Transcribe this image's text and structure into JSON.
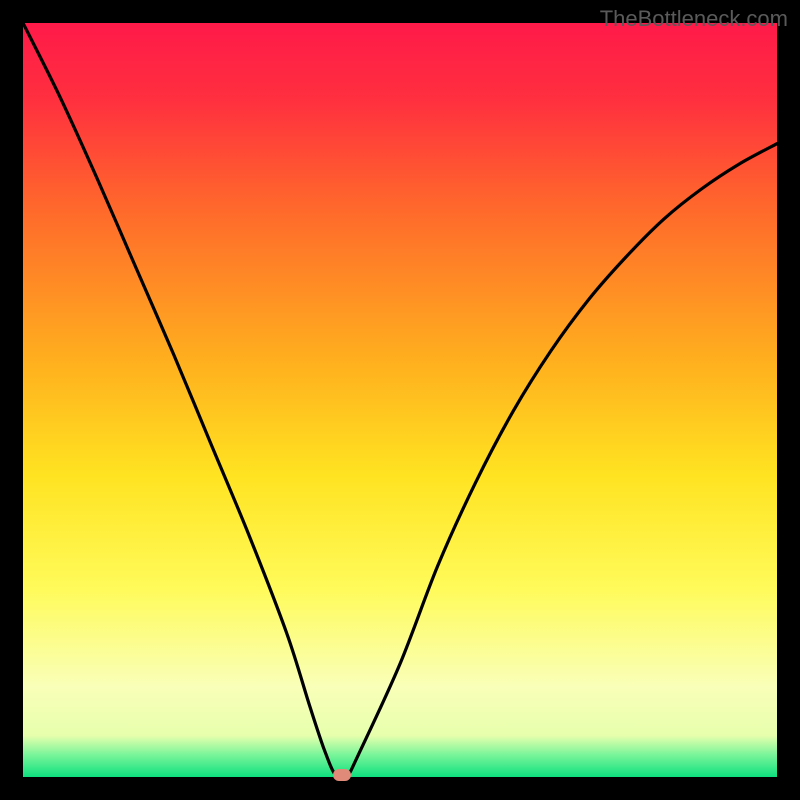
{
  "watermark": "TheBottleneck.com",
  "chart_data": {
    "type": "line",
    "title": "",
    "xlabel": "",
    "ylabel": "",
    "xlim": [
      0,
      100
    ],
    "ylim": [
      0,
      100
    ],
    "gradient_stops": [
      {
        "pos": 0.0,
        "color": "#ff1a49"
      },
      {
        "pos": 0.1,
        "color": "#ff2f3f"
      },
      {
        "pos": 0.25,
        "color": "#ff6a2b"
      },
      {
        "pos": 0.45,
        "color": "#ffb01e"
      },
      {
        "pos": 0.6,
        "color": "#ffe321"
      },
      {
        "pos": 0.75,
        "color": "#fffb5a"
      },
      {
        "pos": 0.88,
        "color": "#f9ffb8"
      },
      {
        "pos": 0.945,
        "color": "#e7ffad"
      },
      {
        "pos": 0.97,
        "color": "#7cf59a"
      },
      {
        "pos": 1.0,
        "color": "#0ee07f"
      }
    ],
    "series": [
      {
        "name": "bottleneck-curve",
        "x": [
          0,
          5,
          10,
          15,
          20,
          25,
          30,
          35,
          38,
          40,
          41.5,
          43,
          44.5,
          50,
          55,
          60,
          65,
          70,
          75,
          80,
          85,
          90,
          95,
          100
        ],
        "y": [
          100,
          90,
          79,
          67.5,
          56,
          44,
          32,
          19,
          9.5,
          3.5,
          0.2,
          0.2,
          3,
          15,
          28,
          39,
          48.5,
          56.5,
          63.3,
          69,
          74,
          78,
          81.3,
          84
        ]
      }
    ],
    "marker": {
      "x": 42.3,
      "y": 0.2,
      "color": "#e08a7a"
    }
  }
}
